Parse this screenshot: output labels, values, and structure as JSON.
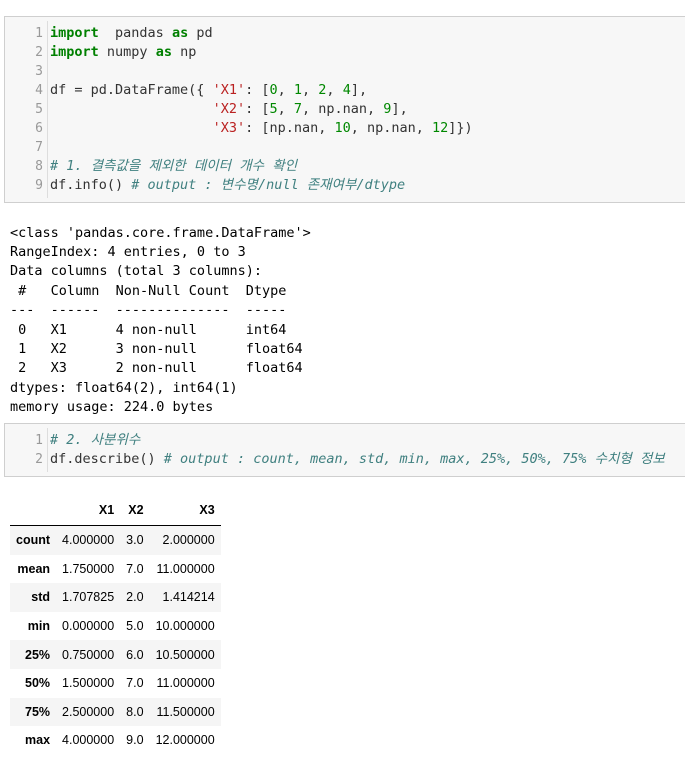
{
  "cell1": {
    "lines": [
      {
        "n": "1",
        "parts": [
          [
            "kw",
            "import"
          ],
          [
            "",
            "  pandas "
          ],
          [
            "kw",
            "as"
          ],
          [
            "",
            " pd"
          ]
        ]
      },
      {
        "n": "2",
        "parts": [
          [
            "kw",
            "import"
          ],
          [
            "",
            " numpy "
          ],
          [
            "kw",
            "as"
          ],
          [
            "",
            " np"
          ]
        ]
      },
      {
        "n": "3",
        "parts": []
      },
      {
        "n": "4",
        "parts": [
          [
            "",
            "df = pd.DataFrame({ "
          ],
          [
            "str",
            "'X1'"
          ],
          [
            "",
            ": ["
          ],
          [
            "num",
            "0"
          ],
          [
            "",
            ", "
          ],
          [
            "num",
            "1"
          ],
          [
            "",
            ", "
          ],
          [
            "num",
            "2"
          ],
          [
            "",
            ", "
          ],
          [
            "num",
            "4"
          ],
          [
            "",
            "],"
          ]
        ]
      },
      {
        "n": "5",
        "parts": [
          [
            "",
            "                    "
          ],
          [
            "str",
            "'X2'"
          ],
          [
            "",
            ": ["
          ],
          [
            "num",
            "5"
          ],
          [
            "",
            ", "
          ],
          [
            "num",
            "7"
          ],
          [
            "",
            ", np.nan, "
          ],
          [
            "num",
            "9"
          ],
          [
            "",
            "],"
          ]
        ]
      },
      {
        "n": "6",
        "parts": [
          [
            "",
            "                    "
          ],
          [
            "str",
            "'X3'"
          ],
          [
            "",
            ": [np.nan, "
          ],
          [
            "num",
            "10"
          ],
          [
            "",
            ", np.nan, "
          ],
          [
            "num",
            "12"
          ],
          [
            "",
            "]})"
          ]
        ]
      },
      {
        "n": "7",
        "parts": []
      },
      {
        "n": "8",
        "parts": [
          [
            "cmt",
            "# 1. 결측값을 제외한 데이터 개수 확인"
          ]
        ]
      },
      {
        "n": "9",
        "parts": [
          [
            "",
            "df.info() "
          ],
          [
            "cmt",
            "# output : 변수명/null 존재여부/dtype"
          ]
        ]
      }
    ]
  },
  "output_text": "<class 'pandas.core.frame.DataFrame'>\nRangeIndex: 4 entries, 0 to 3\nData columns (total 3 columns):\n #   Column  Non-Null Count  Dtype  \n---  ------  --------------  -----  \n 0   X1      4 non-null      int64  \n 1   X2      3 non-null      float64\n 2   X3      2 non-null      float64\ndtypes: float64(2), int64(1)\nmemory usage: 224.0 bytes",
  "cell2": {
    "lines": [
      {
        "n": "1",
        "parts": [
          [
            "cmt",
            "# 2. 사분위수"
          ]
        ]
      },
      {
        "n": "2",
        "parts": [
          [
            "",
            "df.describe() "
          ],
          [
            "cmt",
            "# output : count, mean, std, min, max, 25%, 50%, 75% 수치형 정보"
          ]
        ]
      }
    ]
  },
  "describe_table": {
    "columns": [
      "",
      "X1",
      "X2",
      "X3"
    ],
    "rows": [
      [
        "count",
        "4.000000",
        "3.0",
        "2.000000"
      ],
      [
        "mean",
        "1.750000",
        "7.0",
        "11.000000"
      ],
      [
        "std",
        "1.707825",
        "2.0",
        "1.414214"
      ],
      [
        "min",
        "0.000000",
        "5.0",
        "10.000000"
      ],
      [
        "25%",
        "0.750000",
        "6.0",
        "10.500000"
      ],
      [
        "50%",
        "1.500000",
        "7.0",
        "11.000000"
      ],
      [
        "75%",
        "2.500000",
        "8.0",
        "11.500000"
      ],
      [
        "max",
        "4.000000",
        "9.0",
        "12.000000"
      ]
    ]
  }
}
